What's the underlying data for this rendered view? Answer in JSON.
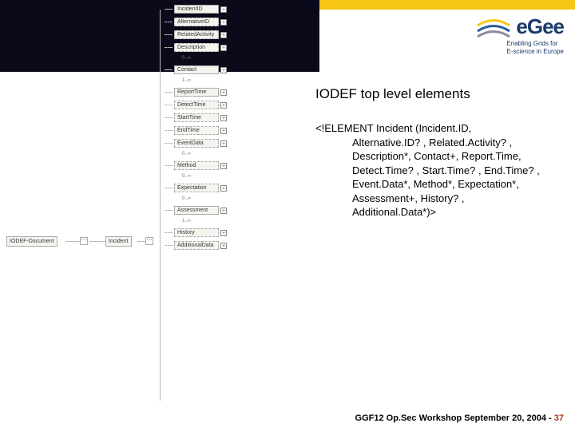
{
  "header": {
    "logo_text": "eGee",
    "tagline_l1": "Enabling Grids for",
    "tagline_l2": "E-science in Europe"
  },
  "diagram": {
    "root": "IODEF-Document",
    "incident": "Incident",
    "children": [
      {
        "label": "IncidentID",
        "optional": false,
        "note": ""
      },
      {
        "label": "AlternativeID",
        "optional": true,
        "note": ""
      },
      {
        "label": "RelatedActivity",
        "optional": true,
        "note": ""
      },
      {
        "label": "Description",
        "optional": true,
        "note": "0..∞"
      },
      {
        "label": "Contact",
        "optional": false,
        "note": "1..∞"
      },
      {
        "label": "ReportTime",
        "optional": false,
        "note": ""
      },
      {
        "label": "DetectTime",
        "optional": true,
        "note": ""
      },
      {
        "label": "StartTime",
        "optional": true,
        "note": ""
      },
      {
        "label": "EndTime",
        "optional": true,
        "note": ""
      },
      {
        "label": "EventData",
        "optional": true,
        "note": "0..∞"
      },
      {
        "label": "Method",
        "optional": true,
        "note": "0..∞"
      },
      {
        "label": "Expectation",
        "optional": true,
        "note": "0..∞"
      },
      {
        "label": "Assessment",
        "optional": false,
        "note": "1..∞"
      },
      {
        "label": "History",
        "optional": true,
        "note": ""
      },
      {
        "label": "AdditionalData",
        "optional": true,
        "note": ""
      }
    ]
  },
  "content": {
    "title": "IODEF top level elements",
    "dtd_open": "<!ELEMENT Incident (Incident.ID,",
    "dtd_l1": "Alternative.ID? , Related.Activity? ,",
    "dtd_l2": "Description*, Contact+, Report.Time,",
    "dtd_l3": "Detect.Time? , Start.Time? , End.Time? ,",
    "dtd_l4": "Event.Data*, Method*, Expectation*,",
    "dtd_l5": "Assessment+, History? ,",
    "dtd_l6": "Additional.Data*)>"
  },
  "footer": {
    "text": "GGF12 Op.Sec Workshop September 20, 2004",
    "sep": " - ",
    "page": "37"
  }
}
